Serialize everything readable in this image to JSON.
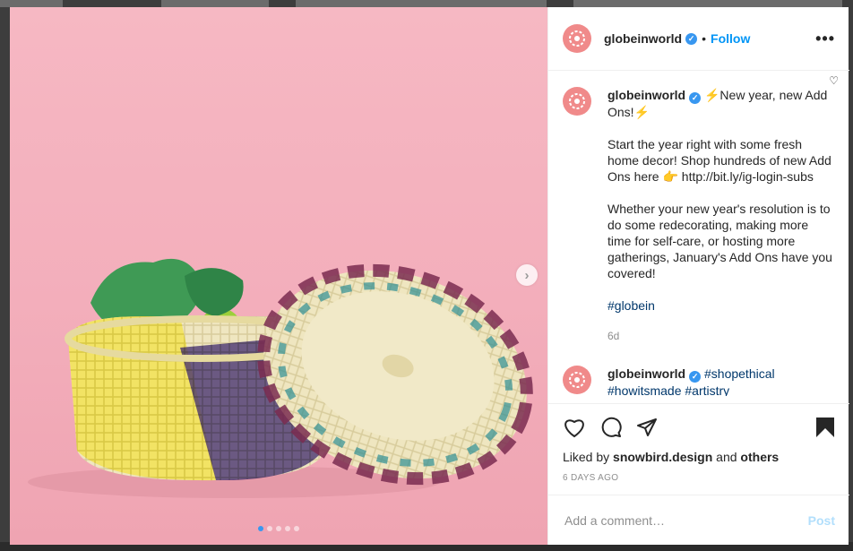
{
  "post": {
    "username": "globeinworld",
    "follow_label": "Follow",
    "more_label": "•••",
    "separator": "•",
    "carousel": {
      "slide_count": 5,
      "active_index": 0
    }
  },
  "caption": {
    "username": "globeinworld",
    "line1": "⚡New year, new Add Ons!⚡",
    "para2": "Start the year right with some fresh home decor! Shop hundreds of new Add Ons here 👉 http://bit.ly/ig-login-subs",
    "para3": "Whether your new year's resolution is to do some redecorating, making more time for self-care, or hosting more gatherings, January's Add Ons have you covered!",
    "hashtag": "#globein",
    "time": "6d"
  },
  "comment2": {
    "username": "globeinworld",
    "text": "#shopethical #howitsmade #artistry"
  },
  "likes": {
    "prefix": "Liked by",
    "user": "snowbird.design",
    "mid": "and",
    "others": "others"
  },
  "date": "6 DAYS AGO",
  "add_comment": {
    "placeholder": "Add a comment…",
    "post_label": "Post"
  },
  "colors": {
    "accent": "#0095f6",
    "avatar": "#f08a8a",
    "photo_bg": "#f4b1bd"
  }
}
